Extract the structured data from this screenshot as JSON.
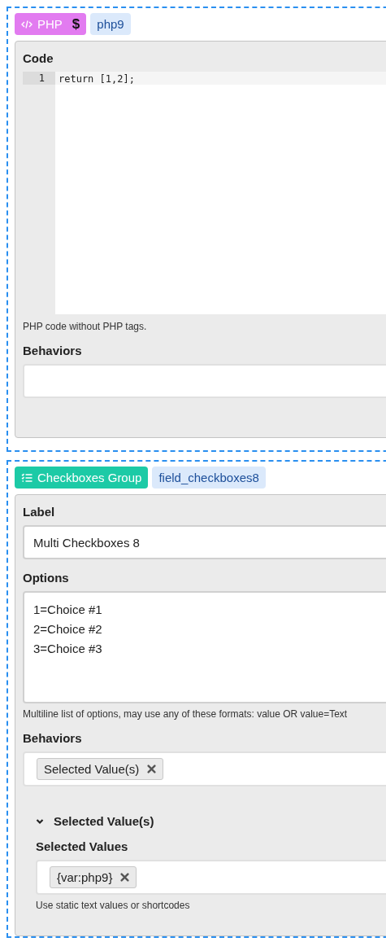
{
  "blocks": [
    {
      "badge": {
        "label": "PHP",
        "kind": "php",
        "suffix": "$",
        "color": "#e27bf0"
      },
      "name": "php9",
      "fields": [
        {
          "kind": "code",
          "label": "Code",
          "lines": [
            {
              "number": "1",
              "text": "return [1,2];"
            }
          ],
          "hint": "PHP code without PHP tags."
        },
        {
          "kind": "tags",
          "label": "Behaviors"
        }
      ]
    },
    {
      "badge": {
        "label": "Checkboxes Group",
        "kind": "checkboxes",
        "color": "#1ccaa6"
      },
      "name": "field_checkboxes8",
      "fields": [
        {
          "kind": "text",
          "label": "Label",
          "value": "Multi Checkboxes 8"
        },
        {
          "kind": "textarea",
          "label": "Options",
          "lines": [
            "1=Choice #1",
            "2=Choice #2",
            "3=Choice #3"
          ],
          "hint": "Multiline list of options, may use any of these formats: value OR value=Text"
        },
        {
          "kind": "tags",
          "label": "Behaviors",
          "tags": [
            "Selected Value(s)"
          ]
        },
        {
          "kind": "section",
          "title": "Selected Value(s)",
          "expanded": true,
          "fields": [
            {
              "kind": "tags",
              "label": "Selected Values",
              "tags": [
                "{var:php9}"
              ],
              "hint": "Use static text values or shortcodes"
            }
          ]
        }
      ]
    }
  ]
}
